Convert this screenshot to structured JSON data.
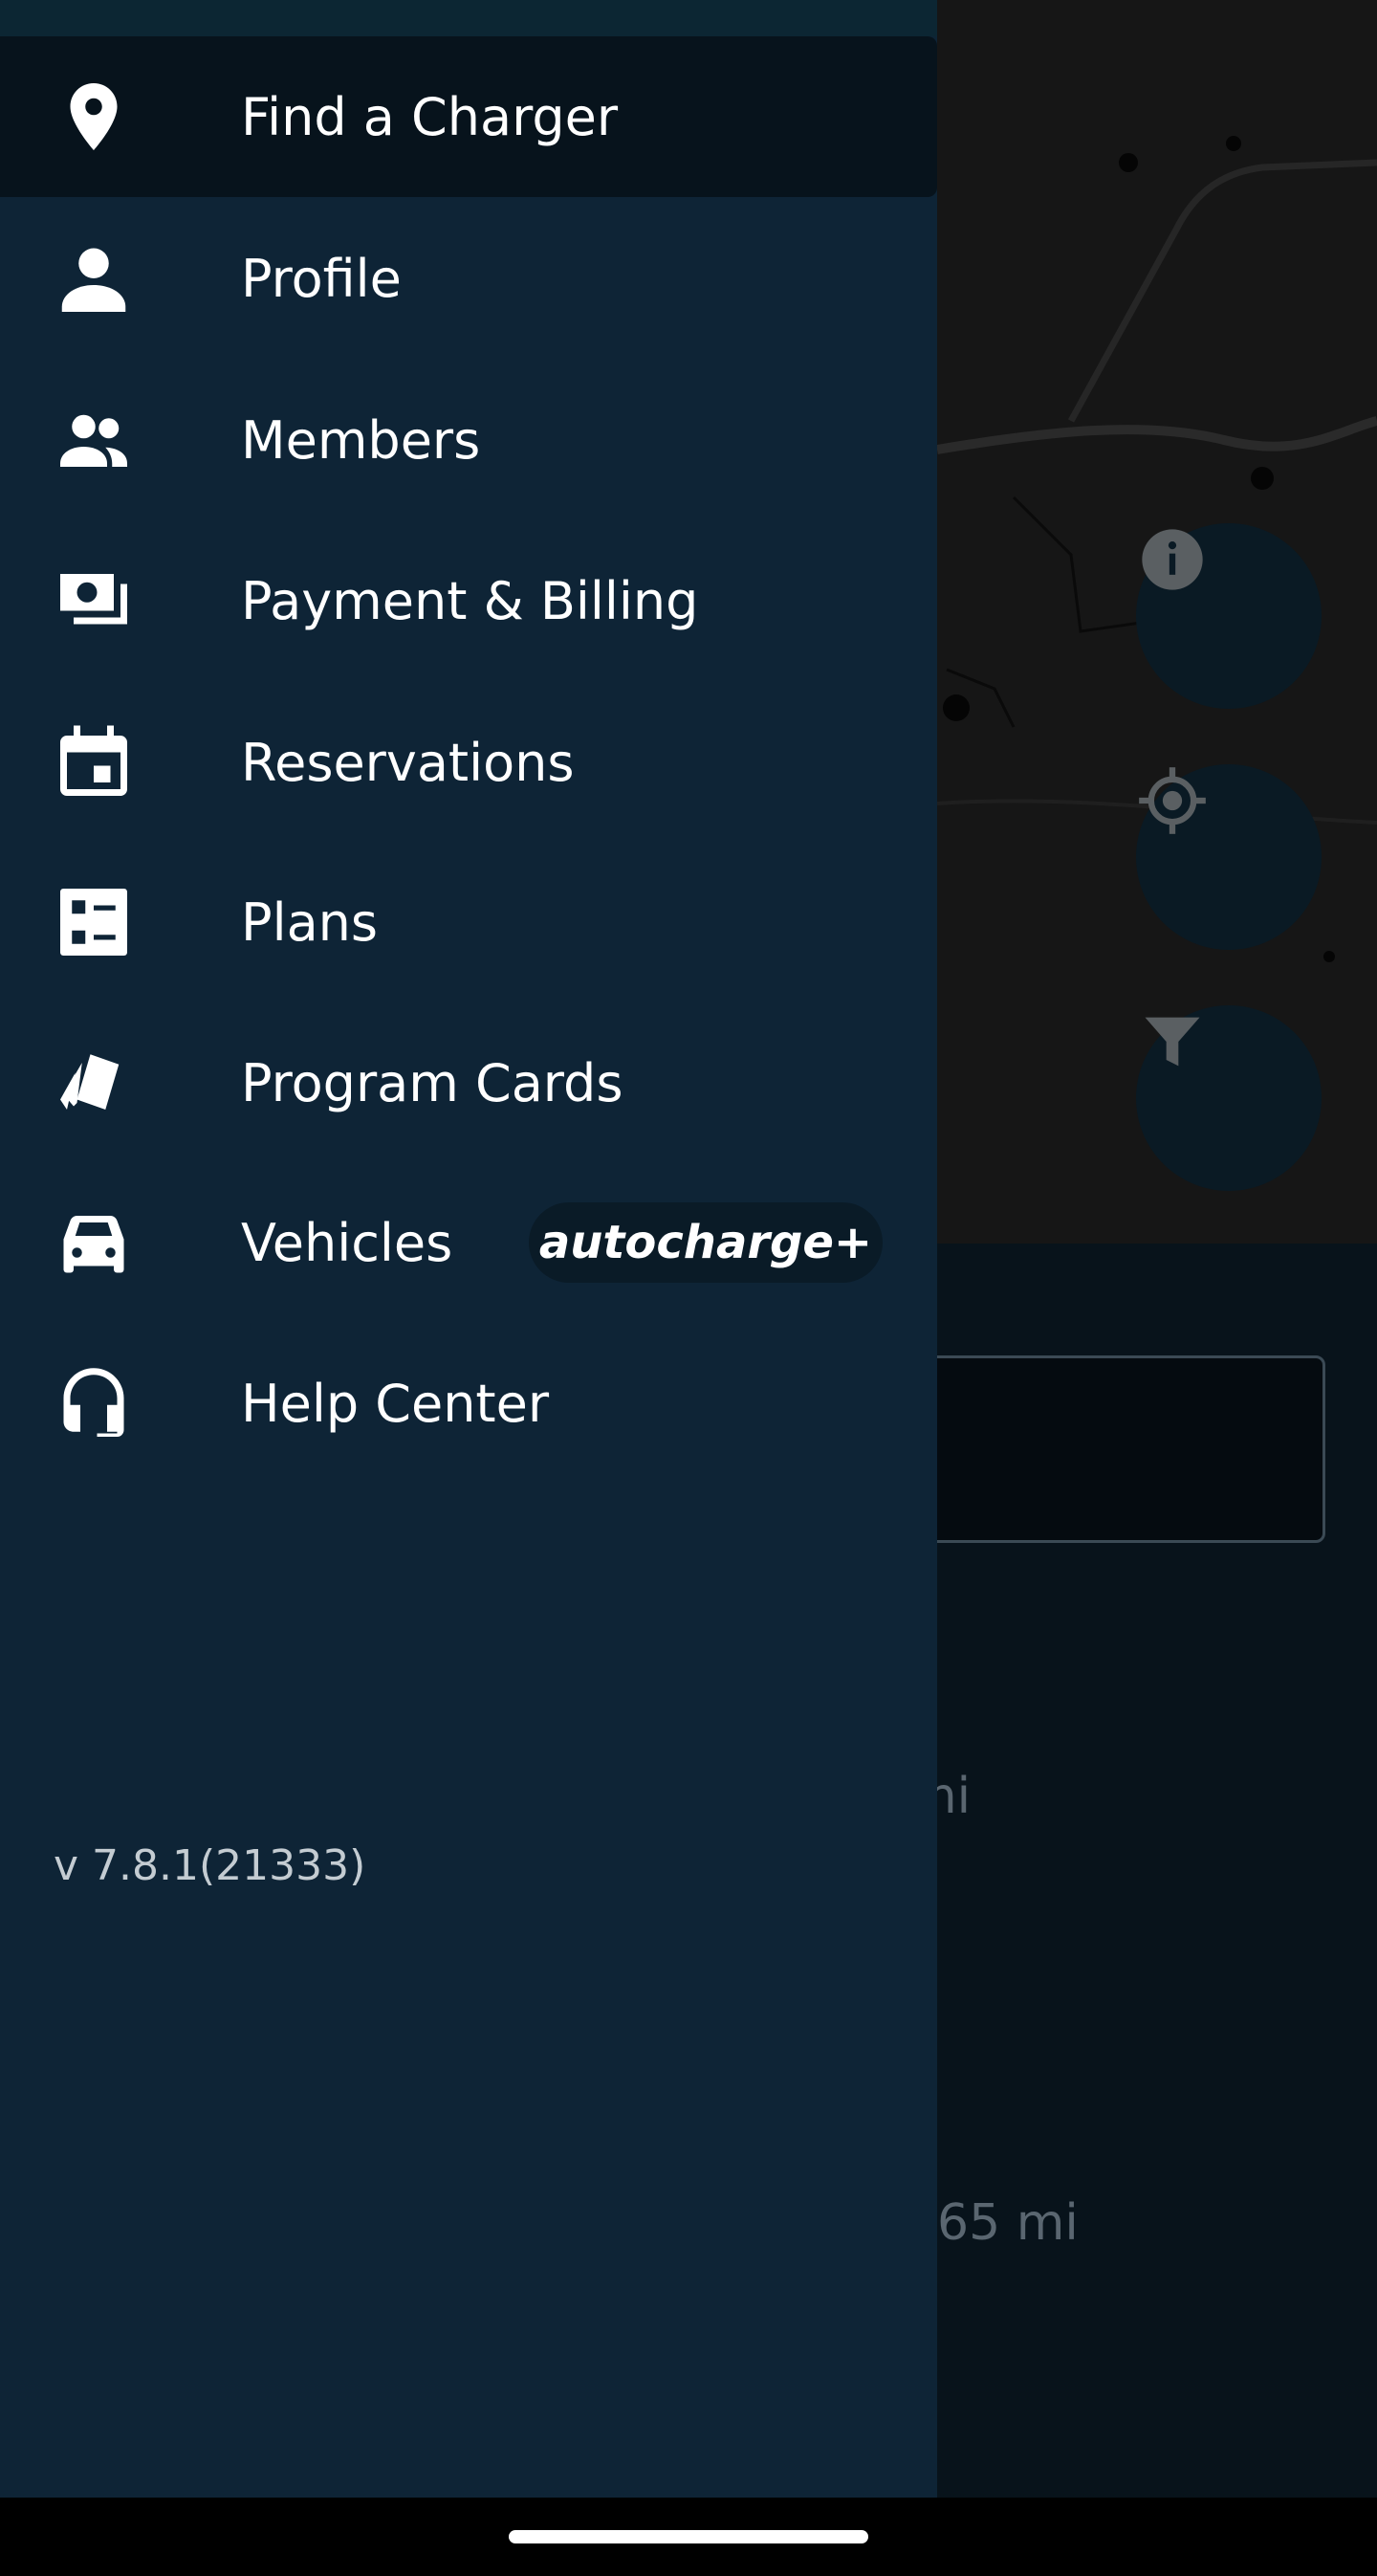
{
  "drawer": {
    "items": [
      {
        "label": "Find a Charger",
        "icon": "location-pin-icon"
      },
      {
        "label": "Profile",
        "icon": "person-icon"
      },
      {
        "label": "Members",
        "icon": "people-icon"
      },
      {
        "label": "Payment & Billing",
        "icon": "money-icon"
      },
      {
        "label": "Reservations",
        "icon": "calendar-icon"
      },
      {
        "label": "Plans",
        "icon": "checklist-icon"
      },
      {
        "label": "Program Cards",
        "icon": "cards-icon"
      },
      {
        "label": "Vehicles",
        "icon": "car-icon",
        "badge": "autocharge+"
      },
      {
        "label": "Help Center",
        "icon": "headset-icon"
      }
    ],
    "active_item": "Find a Charger",
    "version": "v 7.8.1(21333)"
  },
  "background": {
    "fab_icons": [
      "info-icon",
      "my-location-icon",
      "filter-icon"
    ],
    "partial_text_1": "mi",
    "partial_text_2": "65 mi"
  },
  "colors": {
    "drawer_bg": "#0e2436",
    "active_item_bg": "#07131c",
    "text": "#ffffff",
    "version_text": "#c4ccd2"
  }
}
